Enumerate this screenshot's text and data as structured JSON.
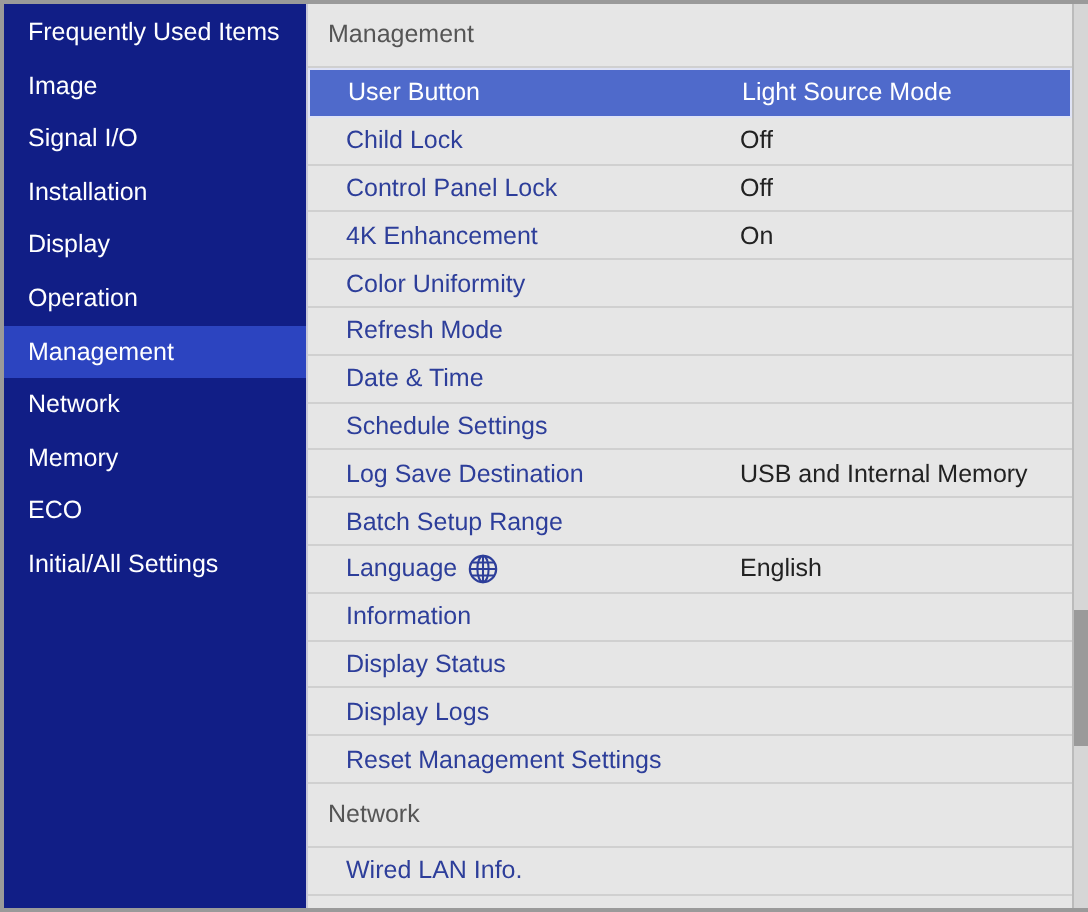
{
  "sidebar": {
    "items": [
      {
        "label": "Frequently Used Items",
        "selected": false
      },
      {
        "label": "Image",
        "selected": false
      },
      {
        "label": "Signal I/O",
        "selected": false
      },
      {
        "label": "Installation",
        "selected": false
      },
      {
        "label": "Display",
        "selected": false
      },
      {
        "label": "Operation",
        "selected": false
      },
      {
        "label": "Management",
        "selected": true
      },
      {
        "label": "Network",
        "selected": false
      },
      {
        "label": "Memory",
        "selected": false
      },
      {
        "label": "ECO",
        "selected": false
      },
      {
        "label": "Initial/All Settings",
        "selected": false
      }
    ]
  },
  "sections": [
    {
      "title": "Management",
      "items": [
        {
          "kind": "plain",
          "label": "User Button",
          "value": "Light Source Mode",
          "selected": true
        },
        {
          "kind": "plain",
          "label": "Child Lock",
          "value": "Off",
          "selected": false
        },
        {
          "kind": "plain",
          "label": "Control Panel Lock",
          "value": "Off",
          "selected": false
        },
        {
          "kind": "plain",
          "label": "4K Enhancement",
          "value": "On",
          "selected": false
        },
        {
          "kind": "plain",
          "label": "Color Uniformity",
          "selected": false
        },
        {
          "kind": "plain",
          "label": "Refresh Mode",
          "selected": false
        },
        {
          "kind": "plain",
          "label": "Date & Time",
          "selected": false
        },
        {
          "kind": "plain",
          "label": "Schedule Settings",
          "selected": false
        },
        {
          "kind": "plain",
          "label": "Log Save Destination",
          "value": "USB and Internal Memory",
          "selected": false
        },
        {
          "kind": "plain",
          "label": "Batch Setup Range",
          "selected": false
        },
        {
          "kind": "globe",
          "label": "Language",
          "value": "English",
          "selected": false
        },
        {
          "kind": "plain",
          "label": "Information",
          "selected": false
        },
        {
          "kind": "plain",
          "label": "Display Status",
          "selected": false
        },
        {
          "kind": "plain",
          "label": "Display Logs",
          "selected": false
        },
        {
          "kind": "plain",
          "label": "Reset Management Settings",
          "selected": false
        }
      ]
    },
    {
      "title": "Network",
      "items": [
        {
          "kind": "plain",
          "label": "Wired LAN Info.",
          "selected": false
        }
      ]
    }
  ]
}
